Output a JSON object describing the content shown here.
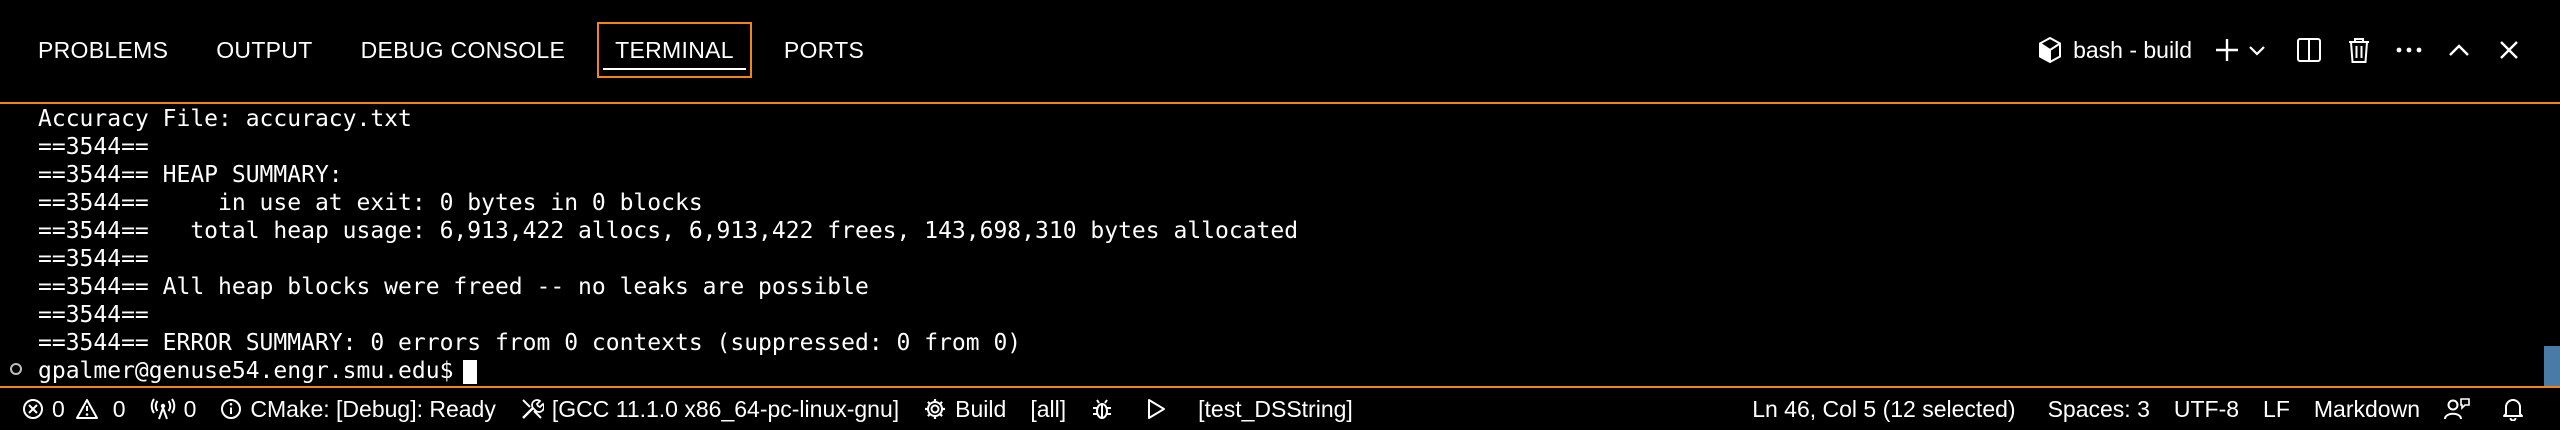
{
  "panel": {
    "tabs": [
      {
        "label": "PROBLEMS"
      },
      {
        "label": "OUTPUT"
      },
      {
        "label": "DEBUG CONSOLE"
      },
      {
        "label": "TERMINAL",
        "active": true
      },
      {
        "label": "PORTS"
      }
    ],
    "terminal_name": "bash - build",
    "actions": [
      "new-terminal-icon",
      "chevron-down-icon",
      "split-terminal-icon",
      "trash-icon",
      "more-icon",
      "maximize-icon",
      "close-icon"
    ]
  },
  "terminal": {
    "lines": [
      "Accuracy File: accuracy.txt",
      "==3544==",
      "==3544== HEAP SUMMARY:",
      "==3544==     in use at exit: 0 bytes in 0 blocks",
      "==3544==   total heap usage: 6,913,422 allocs, 6,913,422 frees, 143,698,310 bytes allocated",
      "==3544==",
      "==3544== All heap blocks were freed -- no leaks are possible",
      "==3544==",
      "==3544== ERROR SUMMARY: 0 errors from 0 contexts (suppressed: 0 from 0)"
    ],
    "prompt": "gpalmer@genuse54.engr.smu.edu$"
  },
  "status_bar": {
    "errors": "0",
    "warnings": "0",
    "ports": "0",
    "cmake_status": "CMake: [Debug]: Ready",
    "kit": "[GCC 11.1.0 x86_64-pc-linux-gnu]",
    "build": "Build",
    "build_target": "[all]",
    "launch_target": "[test_DSString]",
    "cursor_position": "Ln 46, Col 5 (12 selected)",
    "indentation": "Spaces: 3",
    "encoding": "UTF-8",
    "eol": "LF",
    "language": "Markdown"
  },
  "colors": {
    "accent": "#f38518",
    "background": "#000000",
    "scrollbar": "#4a7aa6"
  }
}
